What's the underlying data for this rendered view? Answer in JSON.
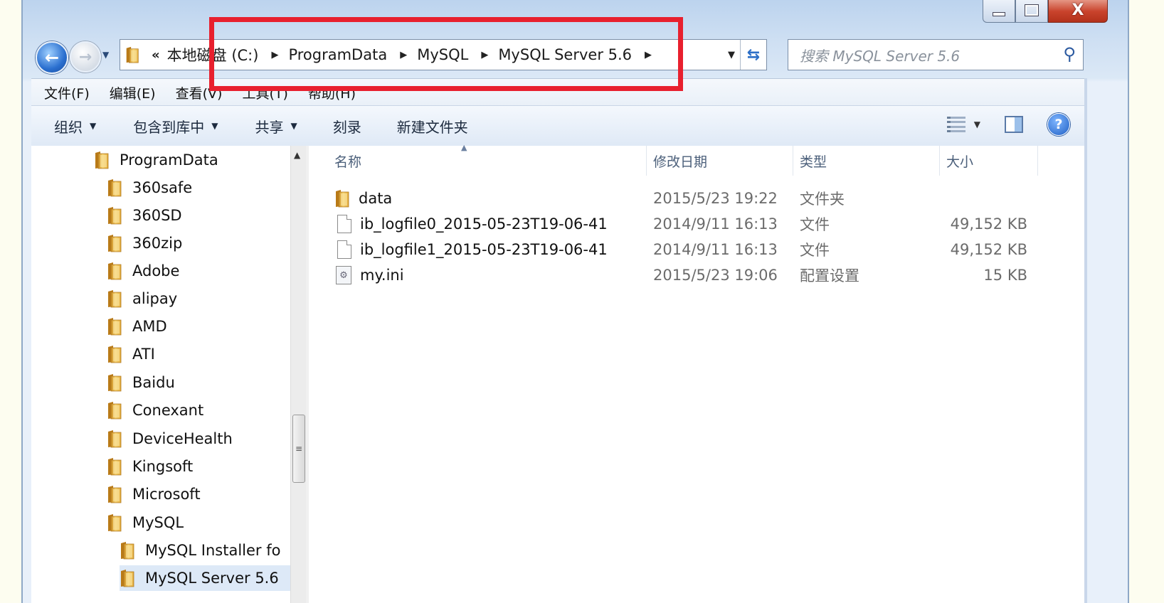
{
  "window": {
    "caption": {
      "minimize": "–",
      "maximize": "□",
      "close": "X"
    }
  },
  "address": {
    "overflow": "«",
    "crumbs": [
      "本地磁盘 (C:)",
      "ProgramData",
      "MySQL",
      "MySQL Server 5.6"
    ],
    "separator": "▶"
  },
  "search": {
    "placeholder": "搜索 MySQL Server 5.6"
  },
  "menubar": {
    "items": [
      "文件(F)",
      "编辑(E)",
      "查看(V)",
      "工具(T)",
      "帮助(H)"
    ]
  },
  "toolbar": {
    "organize": "组织",
    "include_library": "包含到库中",
    "share": "共享",
    "burn": "刻录",
    "new_folder": "新建文件夹"
  },
  "navpane": {
    "items": [
      {
        "label": "ProgramData",
        "level": 0
      },
      {
        "label": "360safe",
        "level": 1
      },
      {
        "label": "360SD",
        "level": 1
      },
      {
        "label": "360zip",
        "level": 1
      },
      {
        "label": "Adobe",
        "level": 1
      },
      {
        "label": "alipay",
        "level": 1
      },
      {
        "label": "AMD",
        "level": 1
      },
      {
        "label": "ATI",
        "level": 1
      },
      {
        "label": "Baidu",
        "level": 1
      },
      {
        "label": "Conexant",
        "level": 1
      },
      {
        "label": "DeviceHealth",
        "level": 1
      },
      {
        "label": "Kingsoft",
        "level": 1
      },
      {
        "label": "Microsoft",
        "level": 1
      },
      {
        "label": "MySQL",
        "level": 1
      },
      {
        "label": "MySQL Installer fo",
        "level": 2
      },
      {
        "label": "MySQL Server 5.6",
        "level": 2
      }
    ]
  },
  "columns": {
    "name": "名称",
    "modified": "修改日期",
    "type": "类型",
    "size": "大小"
  },
  "files": [
    {
      "name": "data",
      "modified": "2015/5/23 19:22",
      "type": "文件夹",
      "size": "",
      "icon": "folder-icon"
    },
    {
      "name": "ib_logfile0_2015-05-23T19-06-41",
      "modified": "2014/9/11 16:13",
      "type": "文件",
      "size": "49,152 KB",
      "icon": "file-icon"
    },
    {
      "name": "ib_logfile1_2015-05-23T19-06-41",
      "modified": "2014/9/11 16:13",
      "type": "文件",
      "size": "49,152 KB",
      "icon": "file-icon"
    },
    {
      "name": "my.ini",
      "modified": "2015/5/23 19:06",
      "type": "配置设置",
      "size": "15 KB",
      "icon": "settings-file-icon"
    }
  ],
  "colors": {
    "highlight": "#e8202e",
    "folder": "#e8b84a"
  }
}
